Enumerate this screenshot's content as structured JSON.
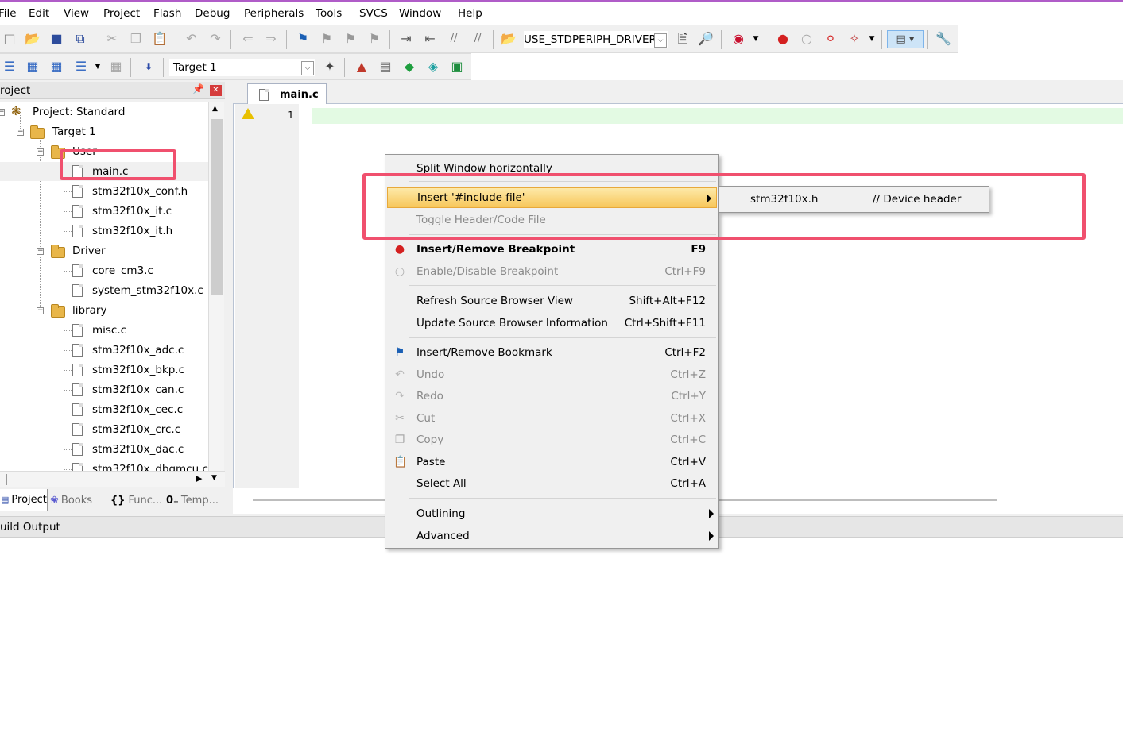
{
  "menubar": {
    "items": [
      "File",
      "Edit",
      "View",
      "Project",
      "Flash",
      "Debug",
      "Peripherals",
      "Tools",
      "SVCS",
      "Window",
      "Help"
    ]
  },
  "toolbar": {
    "define_combo": "USE_STDPERIPH_DRIVER",
    "target_combo": "Target 1",
    "icons": [
      "new-file-icon",
      "open-icon",
      "save-icon",
      "save-all-icon",
      "cut-icon",
      "copy-icon",
      "paste-icon",
      "undo-icon",
      "redo-icon",
      "back-icon",
      "forward-icon",
      "bookmark-icon",
      "prev-bookmark-icon",
      "next-bookmark-icon",
      "clear-bookmarks-icon",
      "indent-icon",
      "unindent-icon",
      "comment-icon",
      "uncomment-icon",
      "find-in-files-icon",
      "find-icon",
      "incremental-find-icon",
      "debug-icon",
      "breakpoint-icon",
      "disable-breakpoint-icon",
      "kill-breakpoints-icon",
      "window-icon",
      "settings-icon"
    ]
  },
  "project_panel": {
    "title": "roject",
    "tree": {
      "project_label": "Project: Standard",
      "target_label": "Target 1",
      "user_group": "User",
      "user_files": [
        "main.c",
        "stm32f10x_conf.h",
        "stm32f10x_it.c",
        "stm32f10x_it.h"
      ],
      "driver_group": "Driver",
      "driver_files": [
        "core_cm3.c",
        "system_stm32f10x.c"
      ],
      "library_group": "library",
      "library_files": [
        "misc.c",
        "stm32f10x_adc.c",
        "stm32f10x_bkp.c",
        "stm32f10x_can.c",
        "stm32f10x_cec.c",
        "stm32f10x_crc.c",
        "stm32f10x_dac.c",
        "stm32f10x_dbgmcu.c"
      ]
    },
    "bottom_tabs": [
      "Project",
      "Books",
      "Func...",
      "Temp..."
    ]
  },
  "editor": {
    "tab": "main.c",
    "line_number": "1"
  },
  "build_output": {
    "title": "uild Output"
  },
  "context_menu": {
    "split": "Split Window horizontally",
    "insert_include": "Insert '#include file'",
    "toggle_header": "Toggle Header/Code File",
    "insert_bp": "Insert/Remove Breakpoint",
    "insert_bp_sc": "F9",
    "enable_bp": "Enable/Disable Breakpoint",
    "enable_bp_sc": "Ctrl+F9",
    "refresh_sb": "Refresh Source Browser View",
    "refresh_sb_sc": "Shift+Alt+F12",
    "update_sb": "Update Source Browser Information",
    "update_sb_sc": "Ctrl+Shift+F11",
    "bookmark": "Insert/Remove Bookmark",
    "bookmark_sc": "Ctrl+F2",
    "undo": "Undo",
    "undo_sc": "Ctrl+Z",
    "redo": "Redo",
    "redo_sc": "Ctrl+Y",
    "cut": "Cut",
    "cut_sc": "Ctrl+X",
    "copy": "Copy",
    "copy_sc": "Ctrl+C",
    "paste": "Paste",
    "paste_sc": "Ctrl+V",
    "select_all": "Select All",
    "select_all_sc": "Ctrl+A",
    "outlining": "Outlining",
    "advanced": "Advanced"
  },
  "submenu": {
    "file": "stm32f10x.h",
    "comment": "// Device header"
  },
  "colors": {
    "highlight_box": "#f0506e",
    "menu_highlight": "#f7c75b",
    "line_highlight": "#e3fae3"
  }
}
